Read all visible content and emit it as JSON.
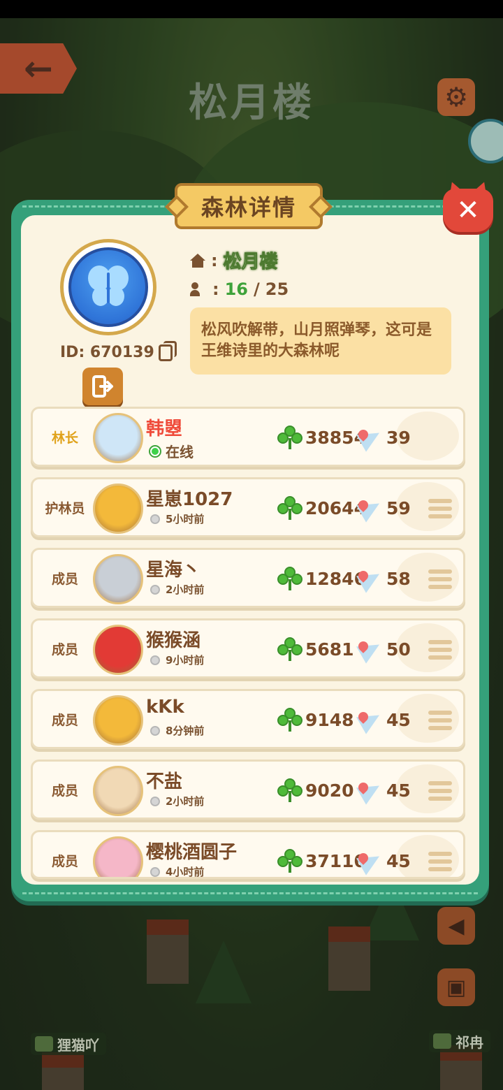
{
  "background": {
    "title": "松月楼",
    "map_tags": [
      "狸猫吖",
      "祁冉"
    ]
  },
  "panel": {
    "title": "森林详情",
    "forest": {
      "id_label": "ID: 670139",
      "name": "松月楼",
      "member_count": "16",
      "member_separator": "/",
      "member_max": "25",
      "description": "松风吹解带，山月照弹琴，这可是王维诗里的大森林呢"
    },
    "members": [
      {
        "role": "林长",
        "name": "韩曌",
        "status": "在线",
        "online": true,
        "score": "38854",
        "likes": "39",
        "avatar_color": "#cfe6f7",
        "has_menu": false
      },
      {
        "role": "护林员",
        "name": "星崽1027",
        "status": "5小时前",
        "online": false,
        "score": "20644",
        "likes": "59",
        "avatar_color": "#f3b93a",
        "has_menu": true
      },
      {
        "role": "成员",
        "name": "星海丶",
        "status": "2小时前",
        "online": false,
        "score": "12846",
        "likes": "58",
        "avatar_color": "#c9cfd6",
        "has_menu": true
      },
      {
        "role": "成员",
        "name": "猴猴涵",
        "status": "9小时前",
        "online": false,
        "score": "5681",
        "likes": "50",
        "avatar_color": "#e23a35",
        "has_menu": true
      },
      {
        "role": "成员",
        "name": "kKk",
        "status": "8分钟前",
        "online": false,
        "score": "9148",
        "likes": "45",
        "avatar_color": "#f3b93a",
        "has_menu": true
      },
      {
        "role": "成员",
        "name": "不盐",
        "status": "2小时前",
        "online": false,
        "score": "9020",
        "likes": "45",
        "avatar_color": "#f1d9b5",
        "has_menu": true
      },
      {
        "role": "成员",
        "name": "樱桃酒圆子",
        "status": "4小时前",
        "online": false,
        "score": "37110",
        "likes": "45",
        "avatar_color": "#f5b7c8",
        "has_menu": true
      }
    ]
  },
  "colors": {
    "panel_frame": "#35a07a",
    "panel_body": "#fbf4e2",
    "title_badge": "#f4c964",
    "close_button": "#e2483a",
    "leader_name": "#ef4b3a",
    "leader_role": "#e0a21a",
    "online_dot": "#3ed14a"
  },
  "icons": [
    "back-arrow-icon",
    "gear-icon",
    "close-icon",
    "butterfly-emblem-icon",
    "copy-icon",
    "exit-icon",
    "home-icon",
    "people-icon",
    "clover-icon",
    "paper-plane-icon",
    "menu-icon"
  ]
}
